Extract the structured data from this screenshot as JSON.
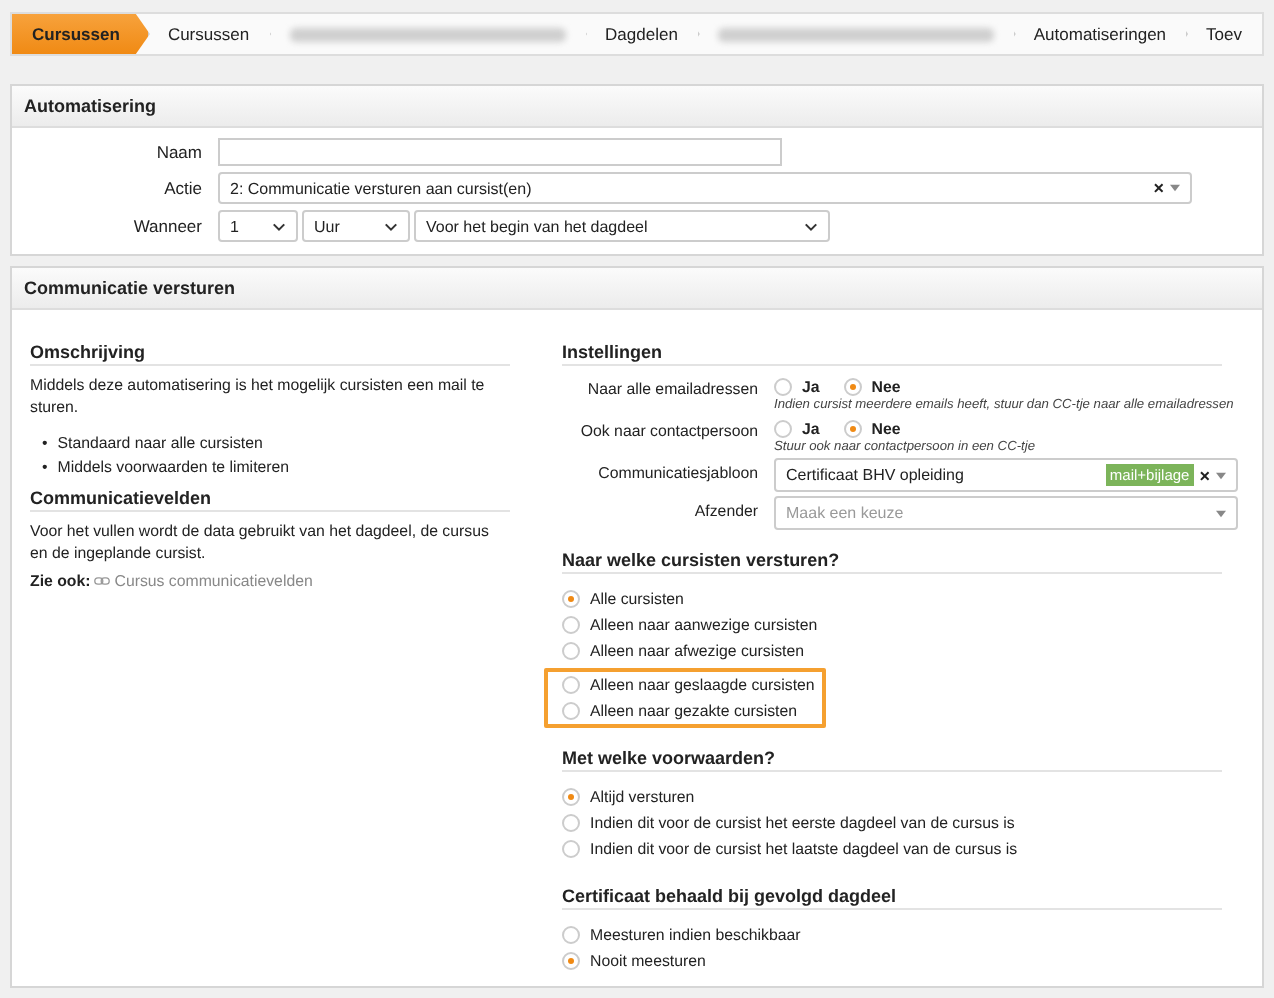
{
  "breadcrumb": [
    {
      "kind": "text",
      "label": "Cursussen",
      "selected": true
    },
    {
      "kind": "text",
      "label": "Cursussen",
      "selected": false
    },
    {
      "kind": "redacted",
      "selected": false
    },
    {
      "kind": "text",
      "label": "Dagdelen",
      "selected": false
    },
    {
      "kind": "redacted",
      "selected": false
    },
    {
      "kind": "text",
      "label": "Automatiseringen",
      "selected": false
    },
    {
      "kind": "text",
      "label": "Toev",
      "selected": false
    }
  ],
  "automatisering": {
    "title": "Automatisering",
    "naam": {
      "label": "Naam"
    },
    "actie": {
      "label": "Actie",
      "value": "2: Communicatie versturen aan cursist(en)",
      "clear": "×"
    },
    "wanneer": {
      "label": "Wanneer",
      "amount": "1",
      "unit": "Uur",
      "moment": "Voor het begin van het dagdeel"
    }
  },
  "communicatie": {
    "title": "Communicatie versturen",
    "omschrijving": {
      "heading": "Omschrijving",
      "text": "Middels deze automatisering is het mogelijk cursisten een mail te sturen.",
      "bullet_marker": "•",
      "bullets": [
        "Standaard naar alle cursisten",
        "Middels voorwaarden te limiteren"
      ]
    },
    "velden": {
      "heading": "Communicatievelden",
      "text": "Voor het vullen wordt de data gebruikt van het dagdeel, de cursus en de ingeplande cursist.",
      "see_also": "Zie ook:",
      "link": "Cursus communicatievelden"
    },
    "instellingen": {
      "heading": "Instellingen",
      "rows": [
        {
          "kind": "yesno",
          "label": "Naar alle emailadressen",
          "options": [
            {
              "label": "Ja",
              "selected": false
            },
            {
              "label": "Nee",
              "selected": true
            }
          ],
          "hint": "Indien cursist meerdere emails heeft, stuur dan CC-tje naar alle emailadressen"
        },
        {
          "kind": "yesno",
          "label": "Ook naar contactpersoon",
          "options": [
            {
              "label": "Ja",
              "selected": false
            },
            {
              "label": "Nee",
              "selected": true
            }
          ],
          "hint": "Stuur ook naar contactpersoon in een CC-tje"
        },
        {
          "kind": "select",
          "label": "Communicatiesjabloon",
          "value": "Certificaat BHV opleiding",
          "tag": "mail+bijlage",
          "clear": "×"
        },
        {
          "kind": "select",
          "label": "Afzender",
          "placeholder": "Maak een keuze"
        }
      ]
    },
    "groups": [
      {
        "heading": "Naar welke cursisten versturen?",
        "options": [
          {
            "label": "Alle cursisten",
            "selected": true,
            "highlighted": false
          },
          {
            "label": "Alleen naar aanwezige cursisten",
            "selected": false,
            "highlighted": false
          },
          {
            "label": "Alleen naar afwezige cursisten",
            "selected": false,
            "highlighted": false
          },
          {
            "label": "Alleen naar geslaagde cursisten",
            "selected": false,
            "highlighted": true
          },
          {
            "label": "Alleen naar gezakte cursisten",
            "selected": false,
            "highlighted": true
          }
        ]
      },
      {
        "heading": "Met welke voorwaarden?",
        "options": [
          {
            "label": "Altijd versturen",
            "selected": true,
            "highlighted": false
          },
          {
            "label": "Indien dit voor de cursist het eerste dagdeel van de cursus is",
            "selected": false,
            "highlighted": false
          },
          {
            "label": "Indien dit voor de cursist het laatste dagdeel van de cursus is",
            "selected": false,
            "highlighted": false
          }
        ]
      },
      {
        "heading": "Certificaat behaald bij gevolgd dagdeel",
        "options": [
          {
            "label": "Meesturen indien beschikbaar",
            "selected": false,
            "highlighted": false
          },
          {
            "label": "Nooit meesturen",
            "selected": true,
            "highlighted": false
          }
        ]
      }
    ]
  }
}
